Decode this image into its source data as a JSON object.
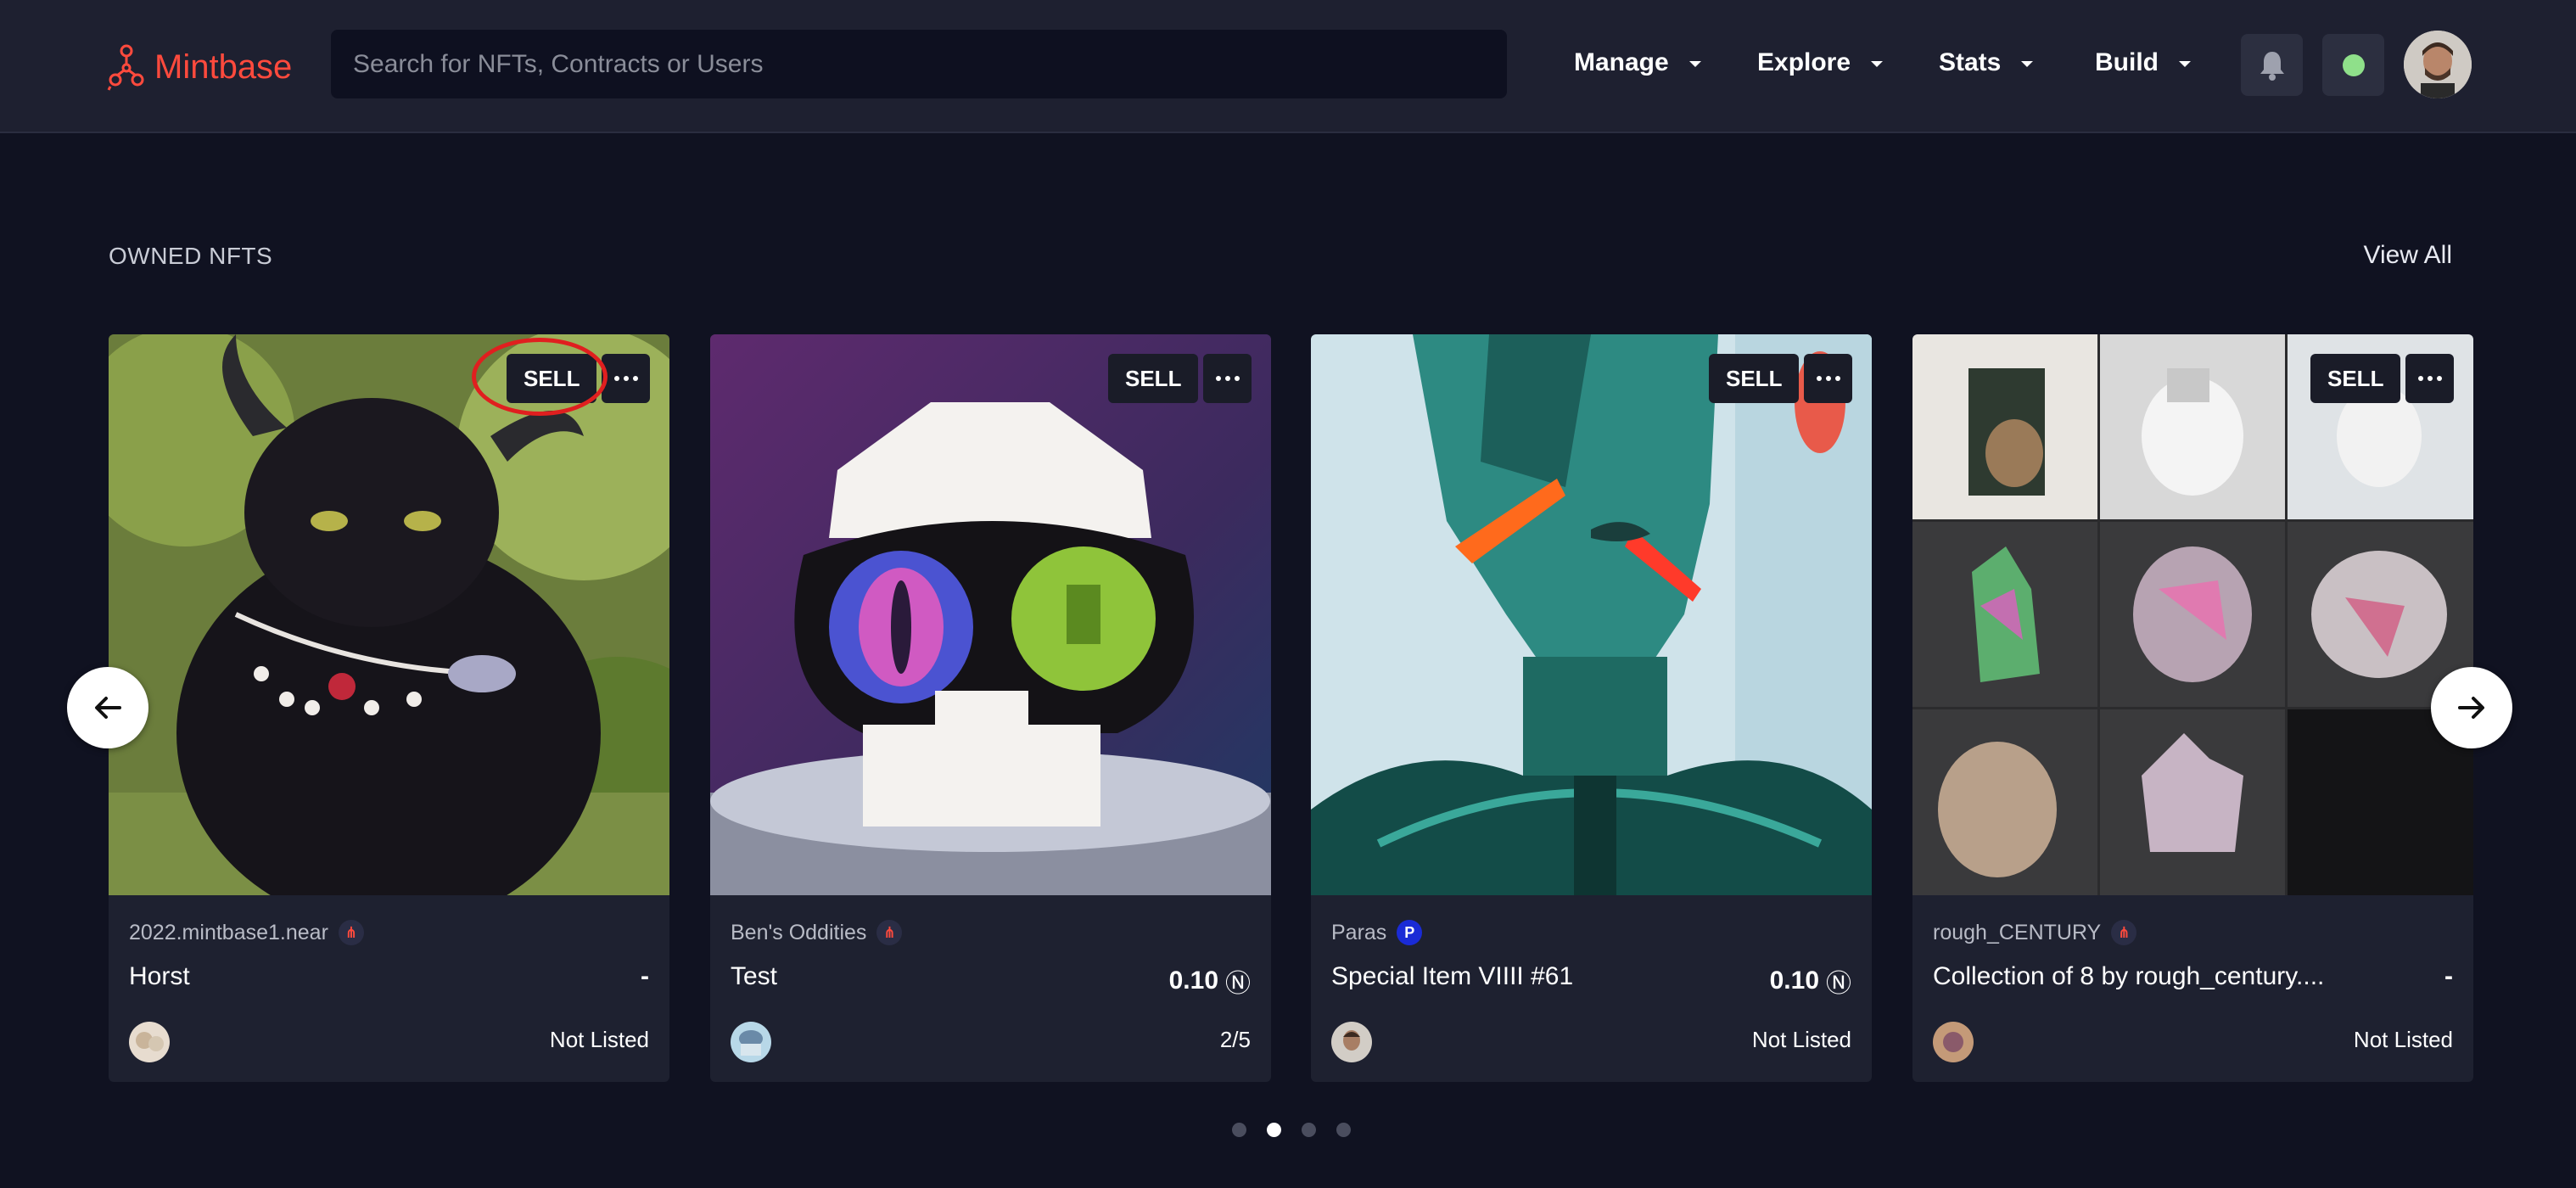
{
  "header": {
    "logo_text": "Mintbase",
    "search_placeholder": "Search for NFTs, Contracts or Users",
    "nav": [
      {
        "label": "Manage"
      },
      {
        "label": "Explore"
      },
      {
        "label": "Stats"
      },
      {
        "label": "Build"
      }
    ],
    "status_color": "#8fe08a"
  },
  "section": {
    "title": "OWNED NFTS",
    "view_all": "View All"
  },
  "cards": [
    {
      "sell_label": "SELL",
      "store": "2022.mintbase1.near",
      "store_badge": "mintbase",
      "title": "Horst",
      "price": "-",
      "status": "Not Listed"
    },
    {
      "sell_label": "SELL",
      "store": "Ben's Oddities",
      "store_badge": "mintbase",
      "title": "Test",
      "price": "0.10",
      "price_symbol": "Ⓝ",
      "status": "2/5"
    },
    {
      "sell_label": "SELL",
      "store": "Paras",
      "store_badge": "P",
      "title": "Special Item VIIII #61",
      "price": "0.10",
      "price_symbol": "Ⓝ",
      "status": "Not Listed"
    },
    {
      "sell_label": "SELL",
      "store": "rough_CENTURY",
      "store_badge": "mintbase",
      "title": "Collection of 8 by rough_century....",
      "price": "-",
      "status": "Not Listed"
    }
  ],
  "carousel": {
    "pages": 4,
    "active_page": 2
  },
  "colors": {
    "background": "#101221",
    "header": "#1e2030",
    "card": "#1e2130",
    "brand": "#ff4a3d",
    "highlight": "#e01f1f"
  }
}
